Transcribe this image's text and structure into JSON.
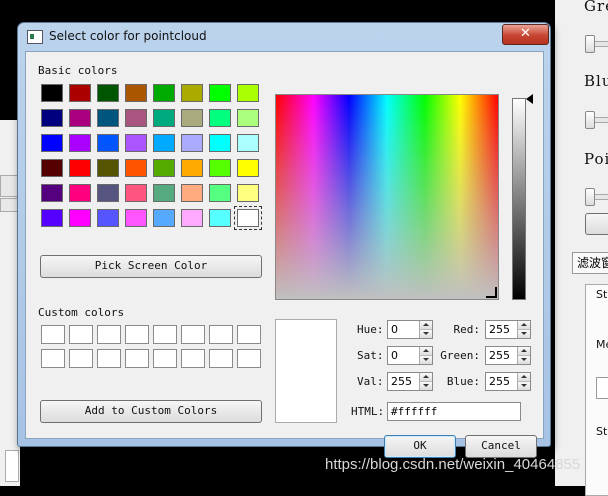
{
  "background_app": {
    "labels": [
      "Gre",
      "Blu",
      "Poi"
    ],
    "button_label": "滤波窗",
    "tab_label": "St",
    "side_labels": [
      "Me",
      "St"
    ]
  },
  "dialog": {
    "title": "Select color for pointcloud",
    "close_glyph": "✕",
    "basic_colors_label": "Basic colors",
    "basic_colors": [
      [
        "#000000",
        "#aa0000",
        "#005500",
        "#aa5500",
        "#00aa00",
        "#aaaa00",
        "#00ff00",
        "#aaff00"
      ],
      [
        "#00007f",
        "#aa007f",
        "#00557f",
        "#aa557f",
        "#00aa7f",
        "#aaaa7f",
        "#00ff7f",
        "#aaff7f"
      ],
      [
        "#0000ff",
        "#aa00ff",
        "#0055ff",
        "#aa55ff",
        "#00aaff",
        "#aaaaff",
        "#00ffff",
        "#aaffff"
      ],
      [
        "#550000",
        "#ff0000",
        "#555500",
        "#ff5500",
        "#55aa00",
        "#ffaa00",
        "#55ff00",
        "#ffff00"
      ],
      [
        "#55007f",
        "#ff007f",
        "#55557f",
        "#ff557f",
        "#55aa7f",
        "#ffaa7f",
        "#55ff7f",
        "#ffff7f"
      ],
      [
        "#5500ff",
        "#ff00ff",
        "#5555ff",
        "#ff55ff",
        "#55aaff",
        "#ffaaff",
        "#55ffff",
        "#ffffff"
      ]
    ],
    "selected_swatch": "#ffffff",
    "pick_screen_button": "Pick Screen Color",
    "custom_colors_label": "Custom colors",
    "custom_slot_count": 16,
    "add_custom_button": "Add to Custom Colors",
    "fields": {
      "hue": {
        "label": "Hue:",
        "value": "0"
      },
      "sat": {
        "label": "Sat:",
        "value": "0"
      },
      "val": {
        "label": "Val:",
        "value": "255"
      },
      "red": {
        "label": "Red:",
        "value": "255"
      },
      "green": {
        "label": "Green:",
        "value": "255"
      },
      "blue": {
        "label": "Blue:",
        "value": "255"
      },
      "html": {
        "label": "HTML:",
        "value": "#ffffff"
      }
    },
    "ok_button": "OK",
    "cancel_button": "Cancel"
  },
  "watermark": "https://blog.csdn.net/weixin_40464855"
}
